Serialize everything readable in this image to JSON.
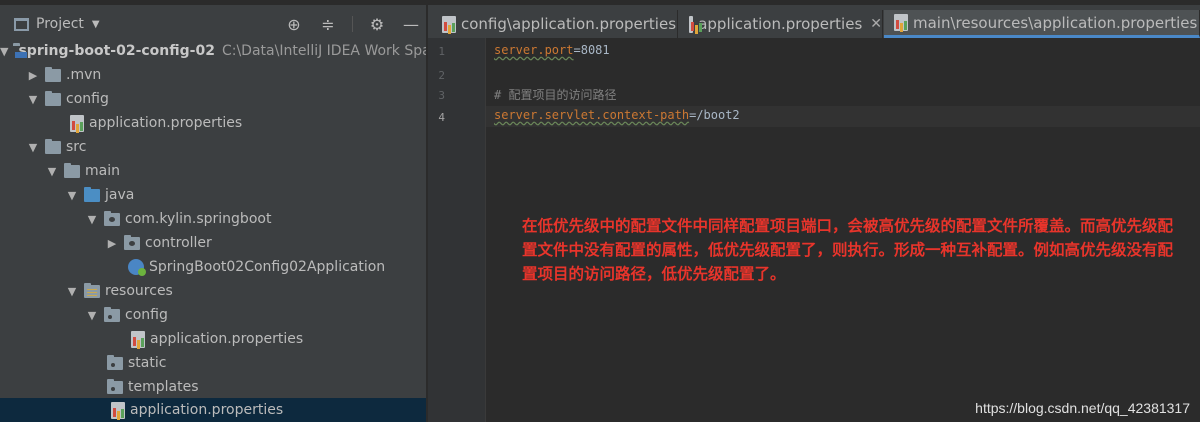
{
  "project_panel": {
    "title": "Project",
    "tree": [
      {
        "label": "spring-boot-02-config-02",
        "path": "C:\\Data\\IntelliJ IDEA Work Spa"
      },
      {
        "label": ".mvn"
      },
      {
        "label": "config"
      },
      {
        "label": "application.properties"
      },
      {
        "label": "src"
      },
      {
        "label": "main"
      },
      {
        "label": "java"
      },
      {
        "label": "com.kylin.springboot"
      },
      {
        "label": "controller"
      },
      {
        "label": "SpringBoot02Config02Application"
      },
      {
        "label": "resources"
      },
      {
        "label": "config"
      },
      {
        "label": "application.properties"
      },
      {
        "label": "static"
      },
      {
        "label": "templates"
      },
      {
        "label": "application.properties"
      }
    ]
  },
  "tabs": [
    {
      "label": "config\\application.properties"
    },
    {
      "label": "application.properties"
    },
    {
      "label": "main\\resources\\application.properties"
    }
  ],
  "editor": {
    "line_numbers": [
      "1",
      "2",
      "3",
      "4"
    ],
    "lines": [
      {
        "key": "server.port",
        "sep": "=",
        "value": "8081"
      },
      {
        "text": ""
      },
      {
        "text": "# 配置项目的访问路径"
      },
      {
        "key": "server.servlet.context-path",
        "sep": "=",
        "value": "/boot2"
      }
    ],
    "annotation": "在低优先级中的配置文件中同样配置项目端口，会被高优先级的配置文件所覆盖。而高优先级配置文件中没有配置的属性，低优先级配置了，则执行。形成一种互补配置。例如高优先级没有配置项目的访问路径，低优先级配置了。"
  },
  "watermark": "https://blog.csdn.net/qq_42381317",
  "colors": {
    "annotation": "#e8342b",
    "selection": "#0d293e",
    "tab_active_underline": "#4a88c7"
  }
}
